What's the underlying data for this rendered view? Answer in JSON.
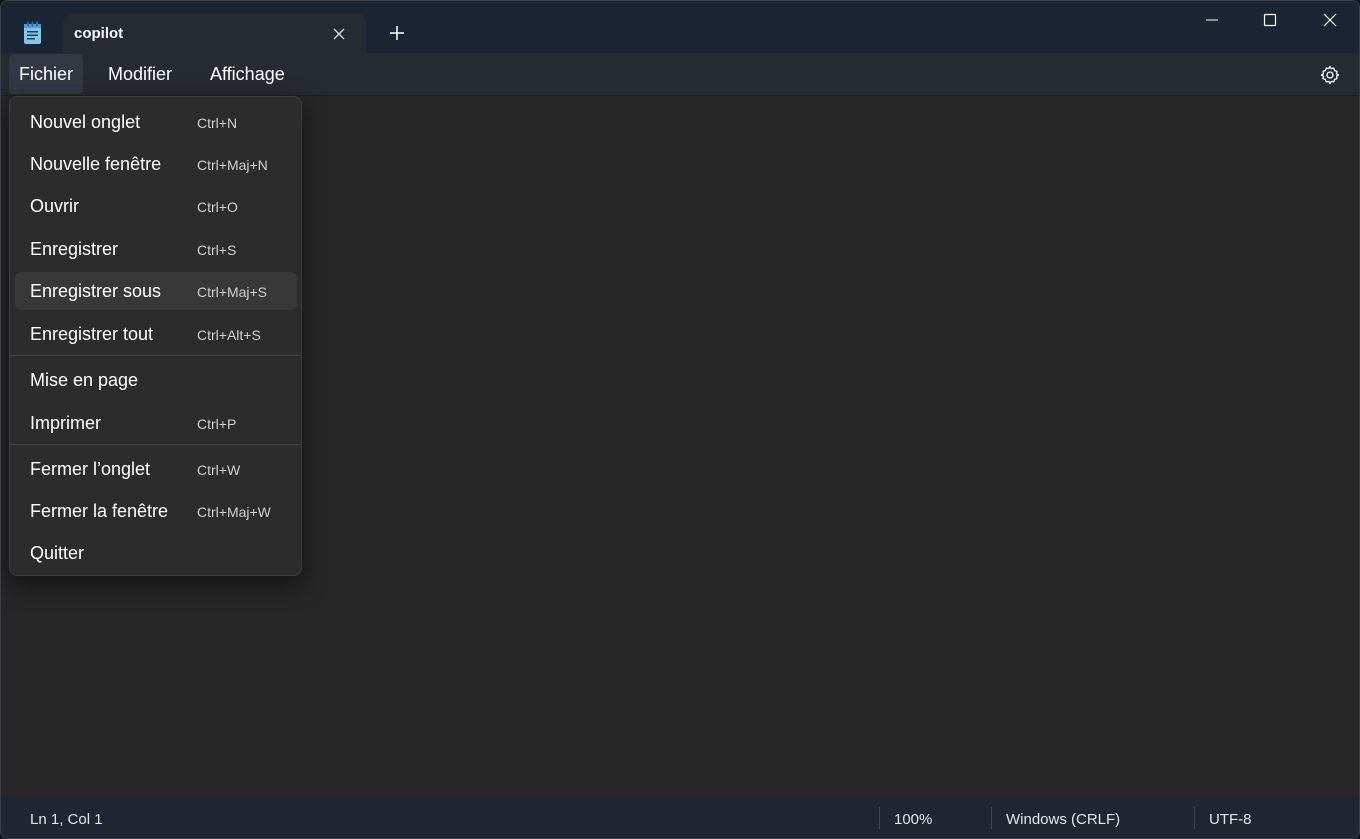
{
  "tab": {
    "title": "copilot"
  },
  "menubar": {
    "items": [
      {
        "label": "Fichier"
      },
      {
        "label": "Modifier"
      },
      {
        "label": "Affichage"
      }
    ]
  },
  "file_menu": {
    "items": [
      {
        "label": "Nouvel onglet",
        "shortcut": "Ctrl+N"
      },
      {
        "label": "Nouvelle fenêtre",
        "shortcut": "Ctrl+Maj+N"
      },
      {
        "label": "Ouvrir",
        "shortcut": "Ctrl+O"
      },
      {
        "label": "Enregistrer",
        "shortcut": "Ctrl+S"
      },
      {
        "label": "Enregistrer sous",
        "shortcut": "Ctrl+Maj+S"
      },
      {
        "label": "Enregistrer tout",
        "shortcut": "Ctrl+Alt+S"
      },
      {
        "label": "Mise en page",
        "shortcut": ""
      },
      {
        "label": "Imprimer",
        "shortcut": "Ctrl+P"
      },
      {
        "label": "Fermer l’onglet",
        "shortcut": "Ctrl+W"
      },
      {
        "label": "Fermer la fenêtre",
        "shortcut": "Ctrl+Maj+W"
      },
      {
        "label": "Quitter",
        "shortcut": ""
      }
    ]
  },
  "statusbar": {
    "position": "Ln 1, Col 1",
    "zoom": "100%",
    "line_ending": "Windows (CRLF)",
    "encoding": "UTF-8"
  },
  "icons": {
    "app": "notepad-icon",
    "tab_close": "close-icon",
    "new_tab": "plus-icon",
    "minimize": "minimize-icon",
    "maximize": "maximize-icon",
    "close": "close-icon",
    "settings": "gear-icon"
  },
  "colors": {
    "titlebar": "#1c2533",
    "menubar": "#262a31",
    "editor": "#272727",
    "menu_bg": "#2c2c2c",
    "statusbar": "#202632"
  }
}
